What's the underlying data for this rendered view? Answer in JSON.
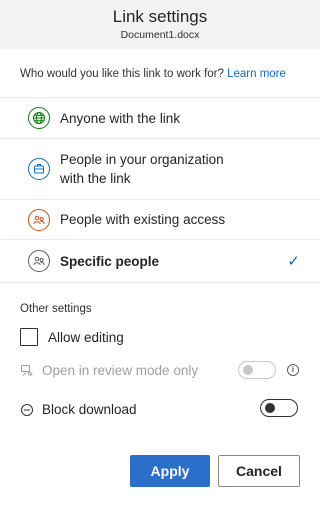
{
  "header": {
    "title": "Link settings",
    "subtitle": "Document1.docx"
  },
  "question": {
    "text": "Who would you like this link to work for?",
    "link": "Learn more"
  },
  "options": [
    {
      "label": "Anyone with the link",
      "icon": "globe-icon",
      "color": "#107c10"
    },
    {
      "label_line1": "People in your organization",
      "label_line2": "with the link",
      "icon": "building-icon",
      "color": "#0f6cbd"
    },
    {
      "label": "People with existing access",
      "icon": "people-icon",
      "color": "#ca5010"
    },
    {
      "label": "Specific people",
      "icon": "people-icon",
      "color": "#605e5c",
      "selected": true,
      "check": "✓"
    }
  ],
  "other_settings": {
    "label": "Other settings",
    "allow_editing": {
      "label": "Allow editing",
      "checked": false
    },
    "review_mode": {
      "label": "Open in review mode only",
      "enabled": false,
      "on": false,
      "info": "i"
    },
    "block_download": {
      "label": "Block download",
      "on": false
    }
  },
  "buttons": {
    "apply": "Apply",
    "cancel": "Cancel"
  }
}
